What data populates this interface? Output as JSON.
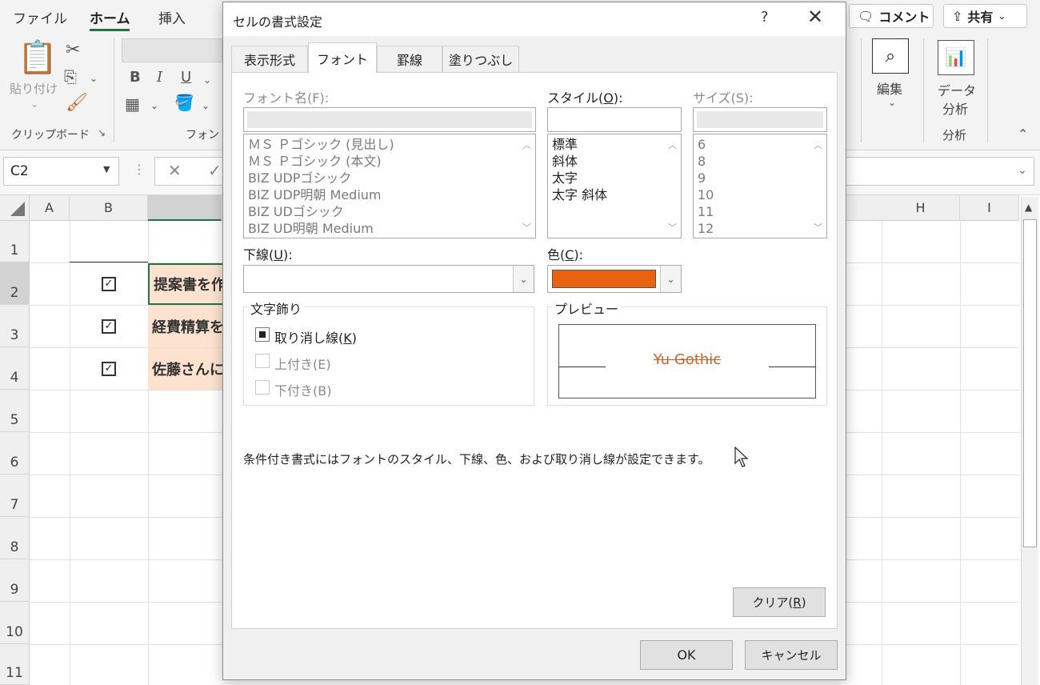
{
  "ribbon": {
    "tabs": [
      "ファイル",
      "ホーム",
      "挿入"
    ],
    "comment_label": "コメント",
    "share_label": "共有",
    "paste_label_1": "貼り付け",
    "clipboard_label": "クリップボード",
    "font_group_label": "フォント",
    "edit_label": "編集",
    "data_analysis_label_1": "データ",
    "data_analysis_label_2": "分析",
    "analysis_group_label": "分析",
    "bold": "B",
    "italic": "I",
    "underline": "U"
  },
  "formula_bar": {
    "name_box": "C2"
  },
  "sheet": {
    "columns": [
      "A",
      "B",
      "H",
      "I"
    ],
    "rows": [
      "1",
      "2",
      "3",
      "4",
      "5",
      "6",
      "7",
      "8",
      "9",
      "10",
      "11"
    ],
    "tasks": [
      "提案書を作",
      "経費精算を",
      "佐藤さんに"
    ],
    "checkbox_mark": "✓"
  },
  "dialog": {
    "title": "セルの書式設定",
    "help": "?",
    "close": "✕",
    "tabs": [
      "表示形式",
      "フォント",
      "罫線",
      "塗りつぶし"
    ],
    "font_name_label": "フォント名(F):",
    "style_label_a": "スタイル(",
    "style_label_key": "O",
    "style_label_b": "):",
    "size_label": "サイズ(S):",
    "font_list": [
      "ＭＳ Ｐゴシック (見出し)",
      "ＭＳ Ｐゴシック (本文)",
      "BIZ UDPゴシック",
      "BIZ UDP明朝 Medium",
      "BIZ UDゴシック",
      "BIZ UD明朝 Medium"
    ],
    "style_list": [
      "標準",
      "斜体",
      "太字",
      "太字 斜体"
    ],
    "size_list": [
      "6",
      "8",
      "9",
      "10",
      "11",
      "12"
    ],
    "underline_label_a": "下線(",
    "underline_label_key": "U",
    "underline_label_b": "):",
    "color_label_a": "色(",
    "color_label_key": "C",
    "color_label_b": "):",
    "selected_color": "#e8620f",
    "effects_label": "文字飾り",
    "strike_label_a": "取り消し線(",
    "strike_label_key": "K",
    "strike_label_b": ")",
    "superscript_label": "上付き(E)",
    "subscript_label": "下付き(B)",
    "preview_label": "プレビュー",
    "preview_text": "Yu Gothic",
    "preview_color": "#c8622a",
    "info_text": "条件付き書式にはフォントのスタイル、下線、色、および取り消し線が設定できます。",
    "clear_label_a": "クリア(",
    "clear_label_key": "R",
    "clear_label_b": ")",
    "ok_label": "OK",
    "cancel_label": "キャンセル"
  }
}
